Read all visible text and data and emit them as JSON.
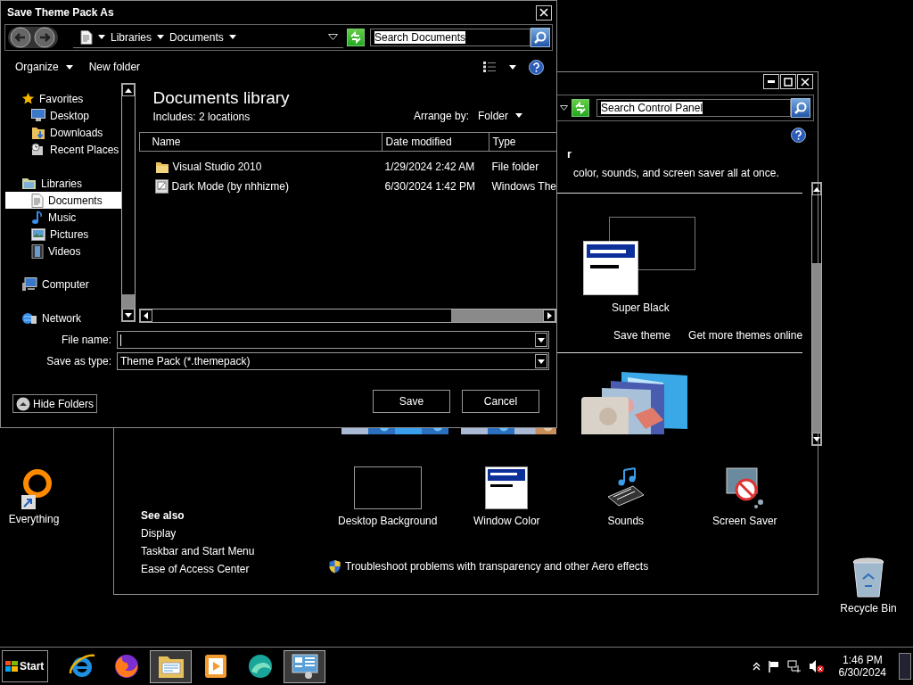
{
  "dialog": {
    "title": "Save Theme Pack As",
    "breadcrumb": [
      "Libraries",
      "Documents"
    ],
    "search": {
      "placeholder": "Search Documents"
    },
    "toolbar": {
      "organize": "Organize",
      "new_folder": "New folder"
    },
    "nav": [
      {
        "label": "Favorites",
        "selected": false,
        "children": [
          {
            "label": "Desktop",
            "selected": false
          },
          {
            "label": "Downloads",
            "selected": false
          },
          {
            "label": "Recent Places",
            "selected": false
          }
        ]
      },
      {
        "label": "Libraries",
        "selected": false,
        "children": [
          {
            "label": "Documents",
            "selected": true
          },
          {
            "label": "Music",
            "selected": false
          },
          {
            "label": "Pictures",
            "selected": false
          },
          {
            "label": "Videos",
            "selected": false
          }
        ]
      },
      {
        "label": "Computer",
        "selected": false
      },
      {
        "label": "Network",
        "selected": false
      }
    ],
    "library": {
      "title": "Documents library",
      "includes": "Includes:  2 locations",
      "arrange_label": "Arrange by:",
      "arrange_value": "Folder"
    },
    "columns": [
      "Name",
      "Date modified",
      "Type"
    ],
    "files": [
      {
        "kind": "folder",
        "name": "Visual Studio 2010",
        "date": "1/29/2024 2:42 AM",
        "type": "File folder"
      },
      {
        "kind": "theme",
        "name": "Dark Mode (by nhhizme)",
        "date": "6/30/2024 1:42 PM",
        "type": "Windows The"
      }
    ],
    "file_name": {
      "label": "File name:"
    },
    "save_type": {
      "label": "Save as type:",
      "value": "Theme Pack (*.themepack)"
    },
    "hide_folders": "Hide Folders",
    "buttons": [
      "Save",
      "Cancel"
    ]
  },
  "control_panel": {
    "search": {
      "placeholder": "Search Control Panel"
    },
    "heading": "r",
    "description": "color, sounds, and screen saver all at once.",
    "theme": {
      "name": "Super Black"
    },
    "theme_links": [
      "Save theme",
      "Get more themes online"
    ],
    "settings": [
      {
        "label": "Desktop Background"
      },
      {
        "label": "Window Color"
      },
      {
        "label": "Sounds"
      },
      {
        "label": "Screen Saver"
      }
    ],
    "troubleshoot": "Troubleshoot problems with transparency and other Aero effects",
    "see_also": {
      "title": "See also",
      "links": [
        "Display",
        "Taskbar and Start Menu",
        "Ease of Access Center"
      ]
    }
  },
  "desktop_icons": [
    {
      "label": "Everything"
    },
    {
      "label": "Recycle Bin"
    }
  ],
  "taskbar": {
    "start": "Start",
    "apps": [
      {
        "selected": false
      },
      {
        "selected": false
      },
      {
        "selected": true
      },
      {
        "selected": false
      },
      {
        "selected": false
      },
      {
        "selected": true
      }
    ],
    "clock": {
      "time": "1:46 PM",
      "date": "6/30/2024"
    }
  }
}
